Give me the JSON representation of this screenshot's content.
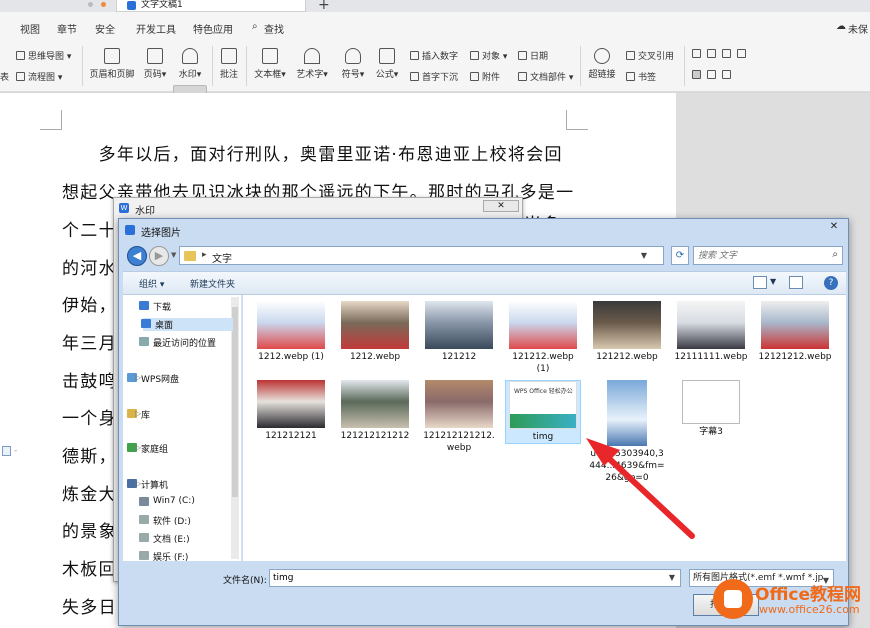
{
  "titlebar": {
    "tab_title": "文字文稿1"
  },
  "menu": {
    "items": [
      "视图",
      "章节",
      "安全",
      "开发工具",
      "特色应用",
      "查找"
    ],
    "right": "未保"
  },
  "ribbon": {
    "mind_map": "思维导图",
    "flowchart": "流程图",
    "table_short": "表",
    "header_footer": "页眉和页脚",
    "page_number": "页码",
    "watermark": "水印",
    "comment": "批注",
    "textbox": "文本框",
    "art_text": "艺术字",
    "symbol": "符号",
    "formula": "公式",
    "insert_number": "插入数字",
    "object": "对象",
    "date": "日期",
    "drop_cap": "首字下沉",
    "attachment": "附件",
    "doc_parts": "文档部件",
    "hyperlink": "超链接",
    "cross_ref": "交叉引用",
    "bookmark": "书签"
  },
  "document": {
    "lines": [
      "　　多年以后，面对行刑队，奥雷里亚诺·布恩迪亚上校将会回",
      "想起父亲带他去见识冰块的那个遥远的下午。那时的马孔多是一",
      "个二十",
      "的河水",
      "伊始，",
      "年三月",
      "击鼓鸣",
      "一个身",
      "德斯，",
      "炼金大",
      "的景象",
      "木板回",
      "失多日"
    ],
    "right_fragment": "当多"
  },
  "watermark_dialog": {
    "title": "水印",
    "close": "✕"
  },
  "picker": {
    "title": "选择图片",
    "close": "✕",
    "path_folder": "文字",
    "search_placeholder": "搜索 文字",
    "organize": "组织 ▾",
    "new_folder": "新建文件夹",
    "help": "?",
    "nav": [
      {
        "label": "下载",
        "indent": true
      },
      {
        "label": "桌面",
        "indent": true,
        "selected": true
      },
      {
        "label": "最近访问的位置",
        "indent": true
      },
      {
        "label": "WPS网盘",
        "indent": false
      },
      {
        "label": "库",
        "indent": false
      },
      {
        "label": "家庭组",
        "indent": false
      },
      {
        "label": "计算机",
        "indent": false
      },
      {
        "label": "Win7 (C:)",
        "indent": true
      },
      {
        "label": "软件 (D:)",
        "indent": true
      },
      {
        "label": "文档 (E:)",
        "indent": true
      },
      {
        "label": "娱乐 (F:)",
        "indent": true
      }
    ],
    "files": [
      {
        "name": "1212.webp (1)"
      },
      {
        "name": "1212.webp"
      },
      {
        "name": "121212"
      },
      {
        "name": "121212.webp (1)"
      },
      {
        "name": "121212.webp"
      },
      {
        "name": "12111111.webp"
      },
      {
        "name": "12121212.webp"
      },
      {
        "name": "121212121"
      },
      {
        "name": "121212121212"
      },
      {
        "name": "121212121212.webp"
      },
      {
        "name": "timg",
        "selected": true,
        "thumb_text": "WPS Office 轻松办公"
      },
      {
        "name": "u=145303940,3444...4639&fm=26&gp=0"
      },
      {
        "name": "字幕3"
      }
    ],
    "filename_label": "文件名(N):",
    "filename_value": "timg",
    "filetype": "所有图片格式(*.emf *.wmf *.jp",
    "open_button": "打开(O)"
  },
  "logo": {
    "line1": "Office教程网",
    "line2": "www.office26.com"
  },
  "colors": {
    "accent": "#2b6fd8",
    "logo": "#f06a1a",
    "arrow": "#e8272b",
    "selection": "#cce8ff"
  }
}
